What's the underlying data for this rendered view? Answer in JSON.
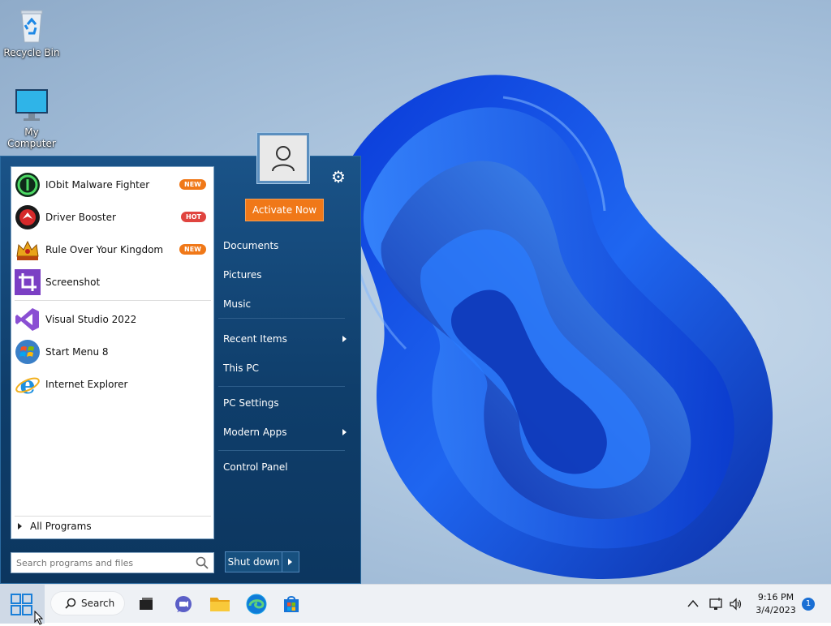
{
  "desktop": {
    "icons": [
      {
        "label": "Recycle Bin",
        "icon": "recycle-bin-icon"
      },
      {
        "label": "My Computer",
        "icon": "monitor-icon"
      }
    ]
  },
  "start_menu": {
    "programs": [
      {
        "label": "IObit Malware Fighter",
        "icon": "iobit-malware-fighter-icon",
        "badge": "NEW",
        "badge_color": "#f07818"
      },
      {
        "label": "Driver Booster",
        "icon": "driver-booster-icon",
        "badge": "HOT",
        "badge_color": "#e0443f"
      },
      {
        "label": "Rule Over Your Kingdom",
        "icon": "kingdom-crown-icon",
        "badge": "NEW",
        "badge_color": "#f07818"
      },
      {
        "label": "Screenshot",
        "icon": "screenshot-crop-icon"
      },
      {
        "label": "Visual Studio 2022",
        "icon": "visual-studio-icon"
      },
      {
        "label": "Start Menu 8",
        "icon": "start-menu-8-icon"
      },
      {
        "label": "Internet Explorer",
        "icon": "internet-explorer-icon"
      }
    ],
    "all_programs": "All Programs",
    "search_placeholder": "Search programs and files",
    "activate": "Activate Now",
    "right_items": [
      {
        "label": "Documents"
      },
      {
        "label": "Pictures"
      },
      {
        "label": "Music"
      },
      {
        "label": "Recent Items",
        "submenu": true
      },
      {
        "label": "This PC"
      },
      {
        "label": "PC Settings"
      },
      {
        "label": "Modern Apps",
        "submenu": true
      },
      {
        "label": "Control Panel"
      }
    ],
    "shutdown": "Shut down",
    "accent": "#f07818"
  },
  "taskbar": {
    "search_label": "Search",
    "apps": [
      "task-view-icon",
      "teams-chat-icon",
      "file-explorer-icon",
      "edge-icon",
      "store-icon"
    ],
    "tray": [
      "chevron-up-icon",
      "network-icon",
      "volume-icon"
    ],
    "time": "9:16 PM",
    "date": "3/4/2023",
    "notifications": "1"
  }
}
